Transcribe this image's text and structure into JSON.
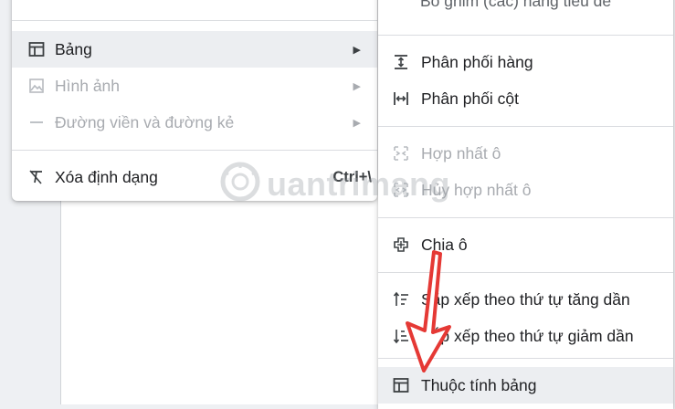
{
  "main_menu": {
    "items": [
      {
        "label": "Bảng",
        "icon": "table-icon",
        "has_submenu": true,
        "disabled": false
      },
      {
        "label": "Hình ảnh",
        "icon": "image-icon",
        "has_submenu": true,
        "disabled": true
      },
      {
        "label": "Đường viền và đường kẻ",
        "icon": "horizontal-line-icon",
        "has_submenu": true,
        "disabled": true
      },
      {
        "label": "Xóa định dạng",
        "icon": "clear-formatting-icon",
        "shortcut": "Ctrl+\\",
        "disabled": false
      }
    ]
  },
  "submenu": {
    "partial_top_label": "Bỏ ghim (các) hàng tiêu đề",
    "items": [
      {
        "label": "Phân phối hàng",
        "icon": "distribute-rows-icon",
        "disabled": false
      },
      {
        "label": "Phân phối cột",
        "icon": "distribute-columns-icon",
        "disabled": false
      },
      {
        "label": "Hợp nhất ô",
        "icon": "merge-cells-icon",
        "disabled": true
      },
      {
        "label": "Hủy hợp nhất ô",
        "icon": "unmerge-cells-icon",
        "disabled": true
      },
      {
        "label": "Chia ô",
        "icon": "split-cell-icon",
        "disabled": false
      },
      {
        "label": "Sắp xếp theo thứ tự tăng dần",
        "icon": "sort-ascending-icon",
        "disabled": false
      },
      {
        "label": "Sắp xếp theo thứ tự giảm dần",
        "icon": "sort-descending-icon",
        "disabled": false
      },
      {
        "label": "Thuộc tính bảng",
        "icon": "table-properties-icon",
        "disabled": false
      }
    ]
  },
  "watermark": {
    "text": "uantrimang"
  },
  "colors": {
    "highlight": "#eceef1",
    "annotation_arrow": "#e53935",
    "disabled_text": "#a8abb0"
  }
}
